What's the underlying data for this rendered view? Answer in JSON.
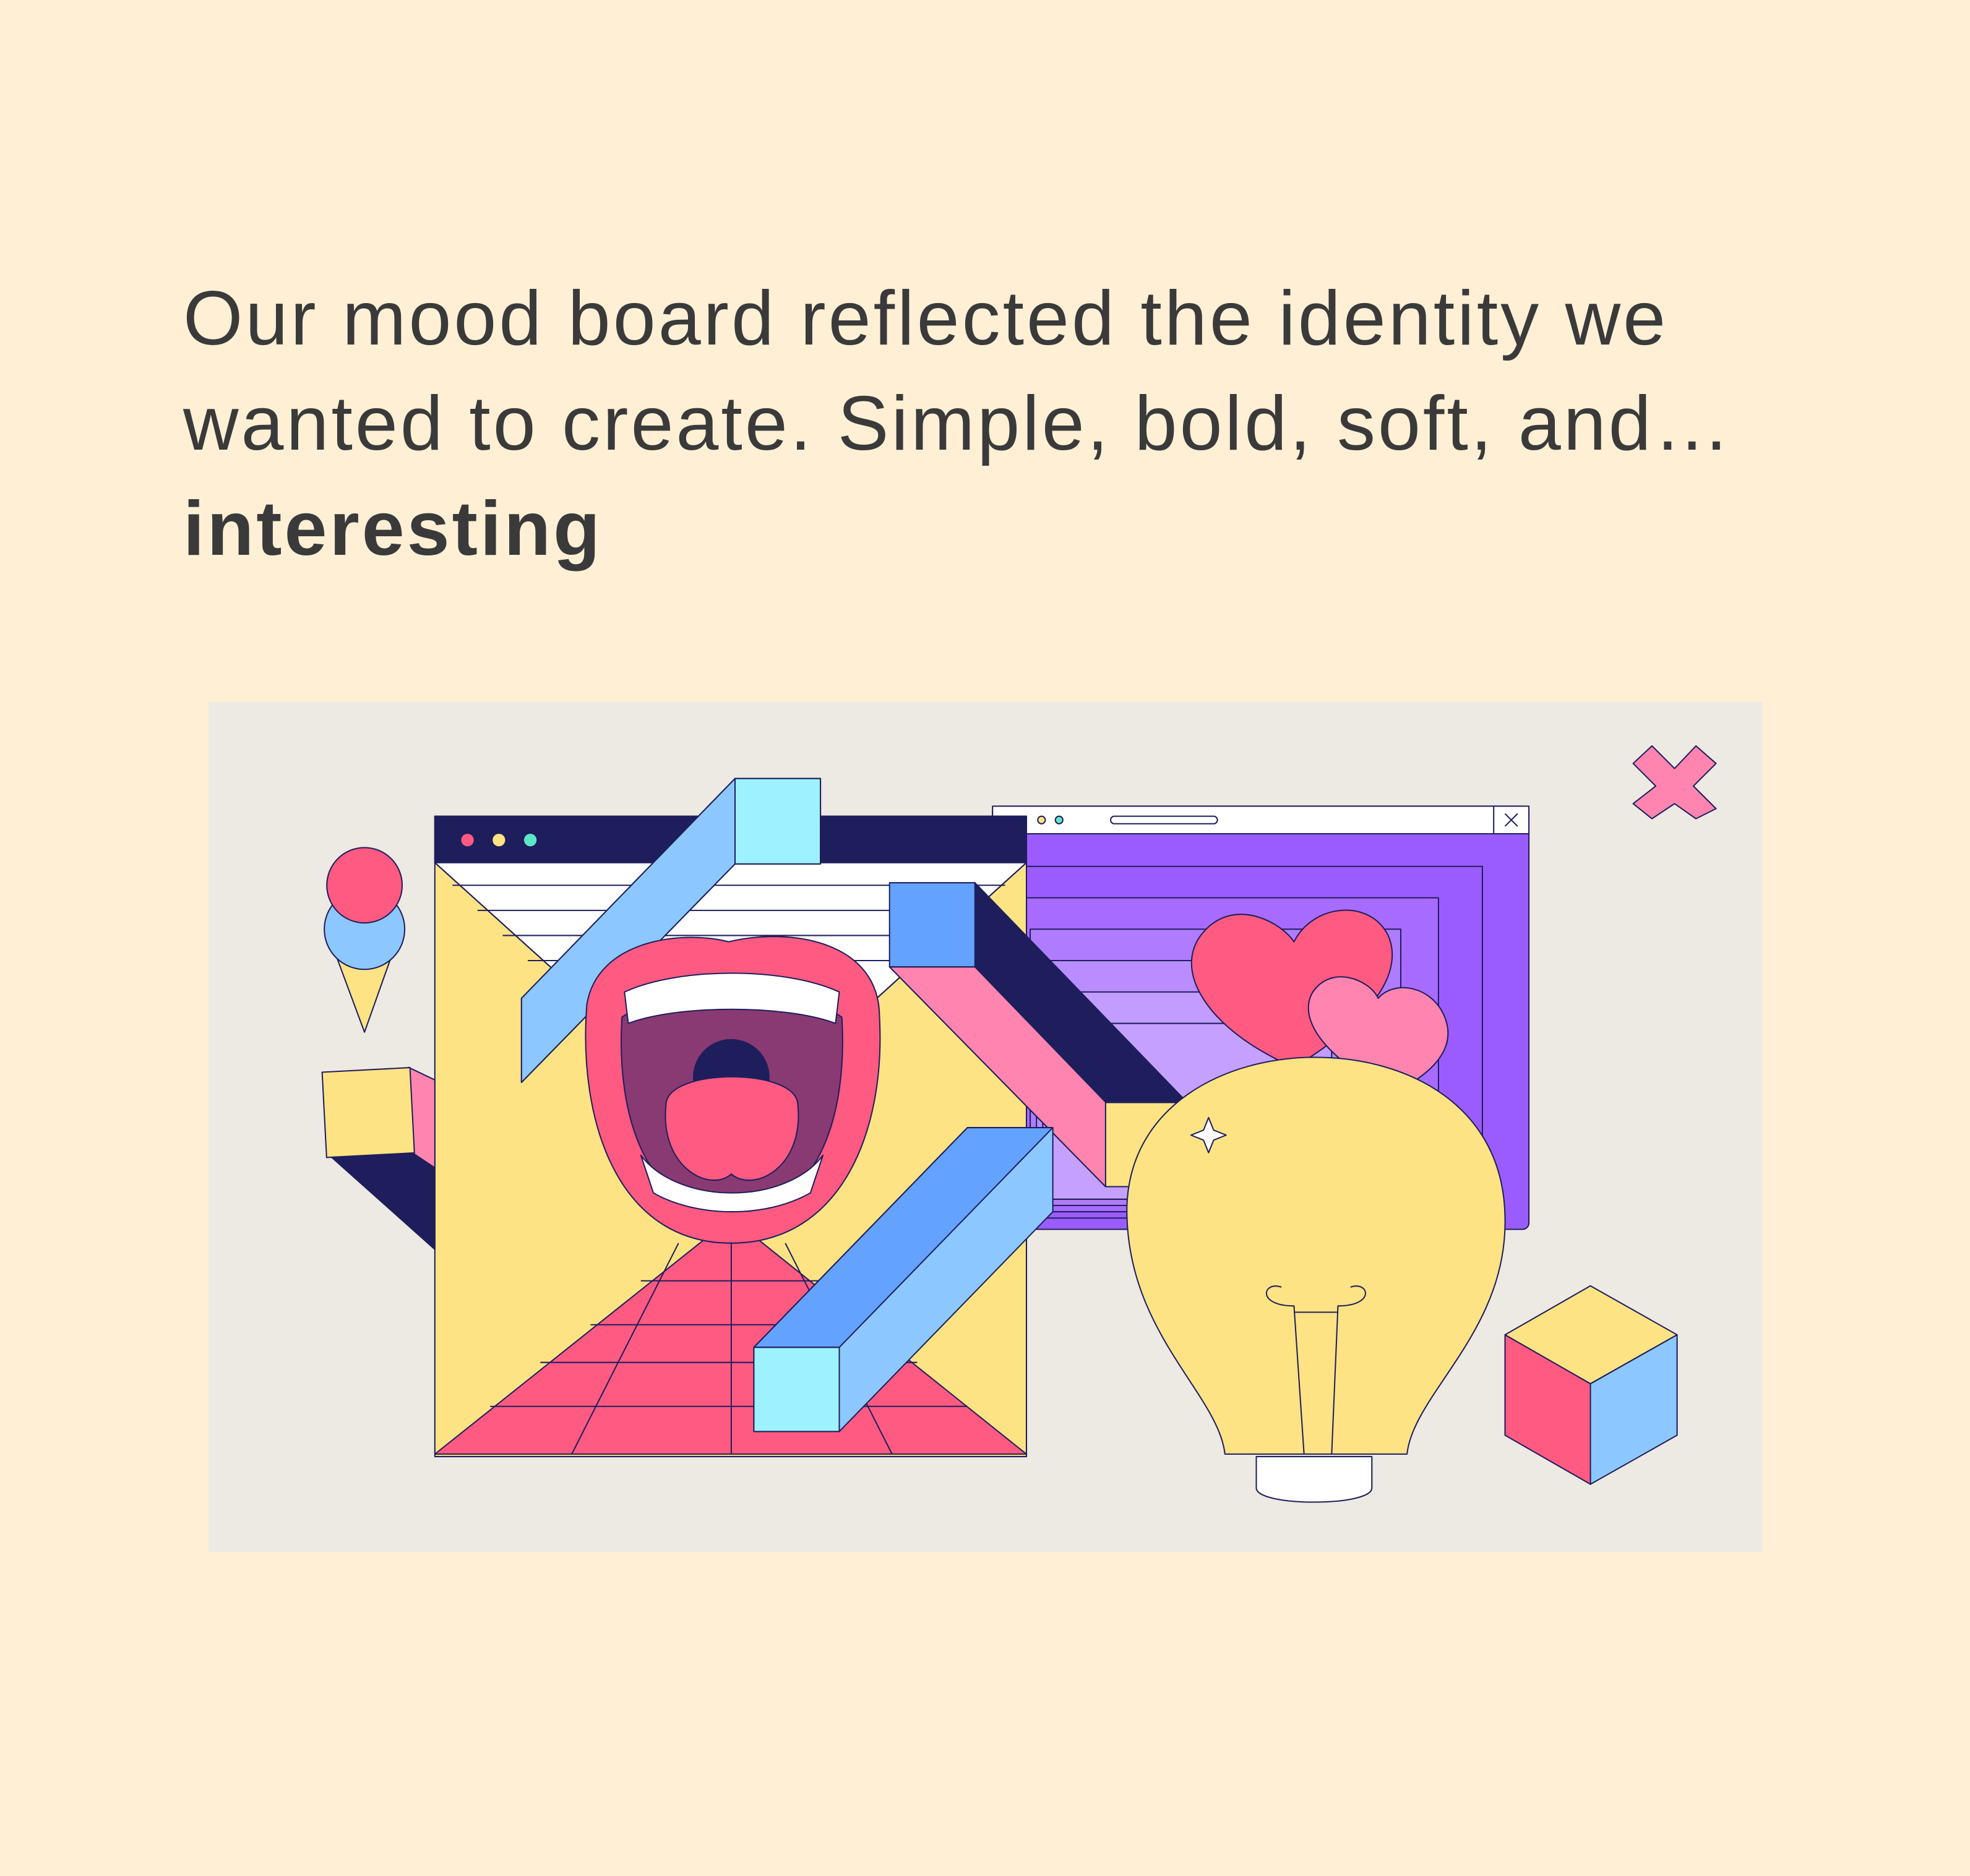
{
  "headline": {
    "text": "Our mood board reflected the identity we wanted to create. Simple, bold, soft, and…",
    "emphasis": "interesting"
  },
  "illustration": {
    "background": "#ede9e3",
    "palette": {
      "navy": "#1e1e5c",
      "pink": "#ff5a82",
      "yellow": "#fde384",
      "blue": "#64a2ff",
      "cyan": "#9ef2ff",
      "purple": "#9b5cff",
      "lilac": "#c6a0ff"
    },
    "icons": [
      "ice-cream-icon",
      "envelope-icon",
      "mouth-icon",
      "browser-window-icon",
      "hearts-icon",
      "light-bulb-icon",
      "rubiks-cube-icon",
      "cross-icon",
      "cube-icon"
    ]
  }
}
